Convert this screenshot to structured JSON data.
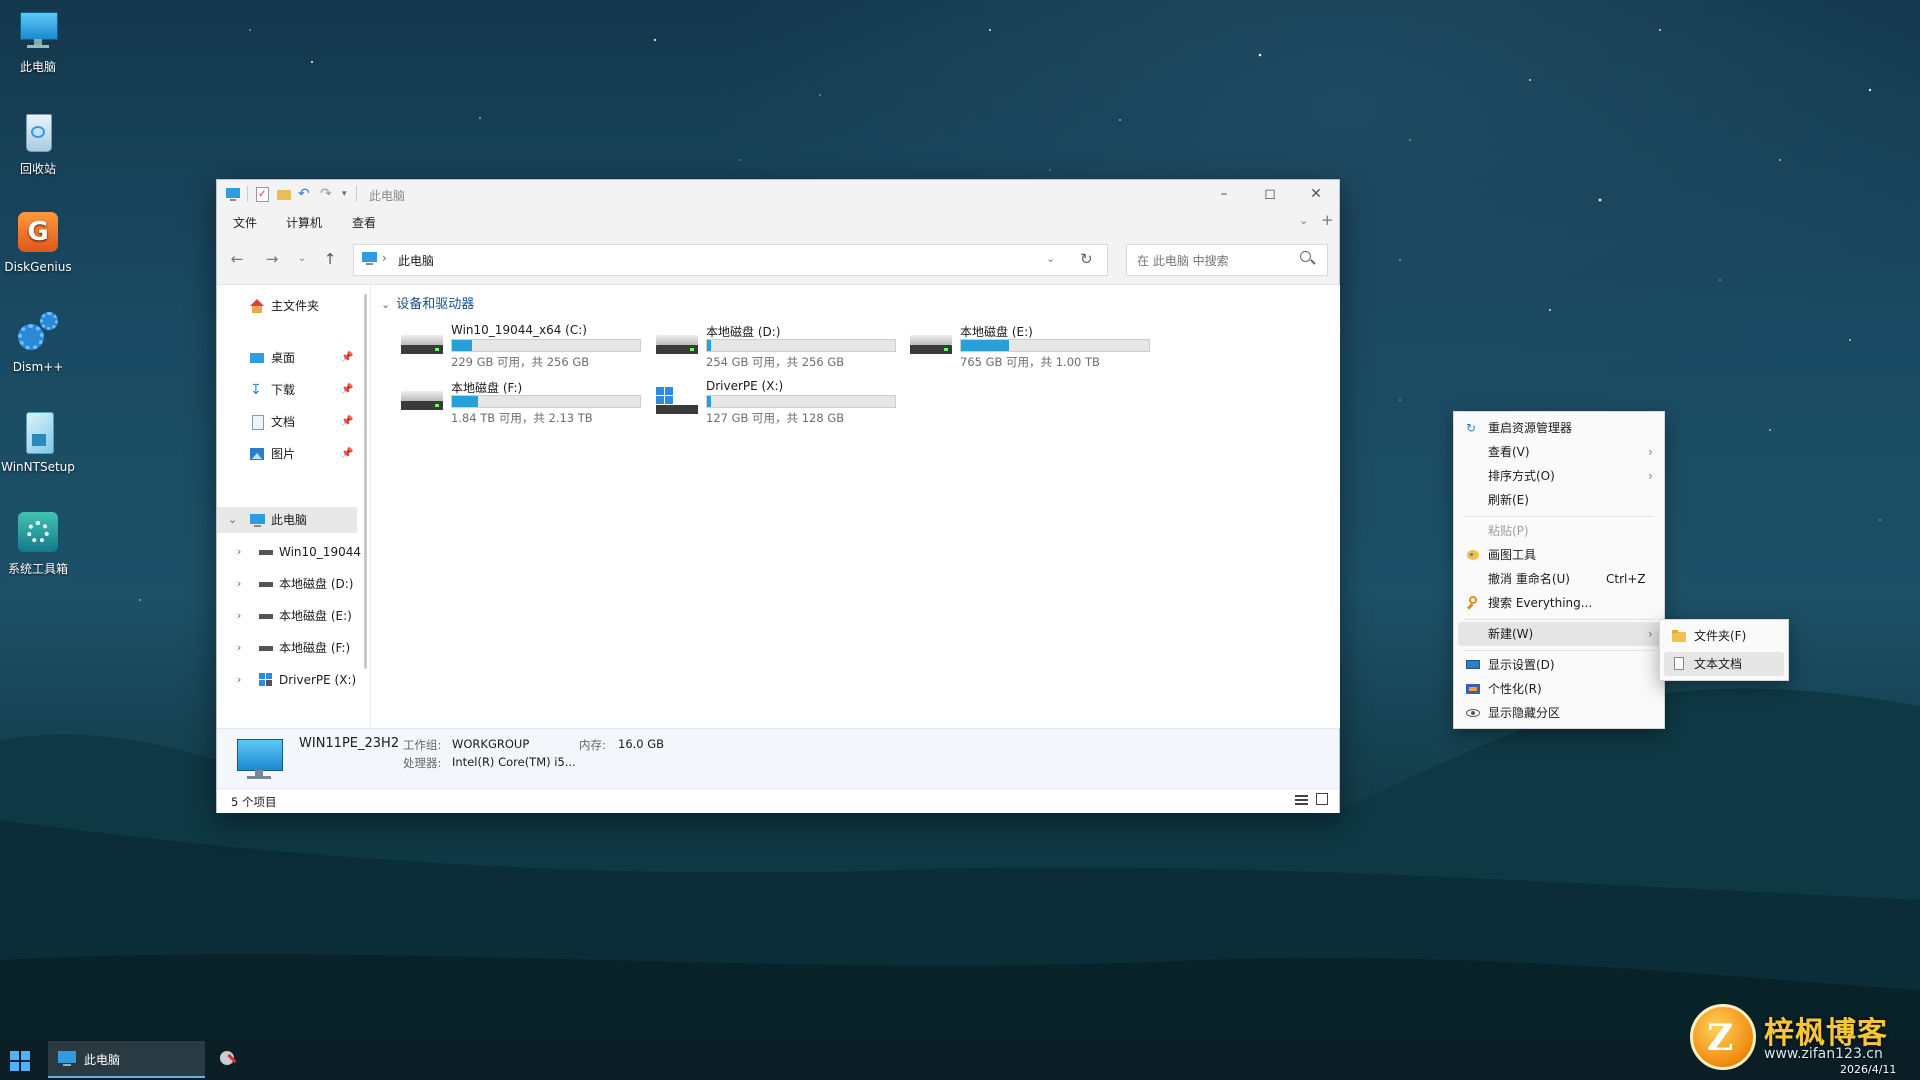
{
  "desktop": {
    "icons": [
      {
        "label": "此电脑",
        "icon": "computer-icon"
      },
      {
        "label": "回收站",
        "icon": "recycle-bin-icon"
      },
      {
        "label": "DiskGenius",
        "icon": "diskgenius-icon"
      },
      {
        "label": "Dism++",
        "icon": "dism-gear-icon"
      },
      {
        "label": "WinNTSetup",
        "icon": "winntsetup-icon"
      },
      {
        "label": "系统工具箱",
        "icon": "system-toolbox-icon"
      }
    ]
  },
  "explorer": {
    "title": "此电脑",
    "menu": [
      "文件",
      "计算机",
      "查看"
    ],
    "address": "此电脑",
    "search_placeholder": "在 此电脑 中搜索",
    "nav": {
      "home": "主文件夹",
      "quick": [
        {
          "label": "桌面",
          "icon": "desktop-folder-icon"
        },
        {
          "label": "下载",
          "icon": "download-icon"
        },
        {
          "label": "文档",
          "icon": "document-icon"
        },
        {
          "label": "图片",
          "icon": "picture-icon"
        }
      ],
      "this_pc": "此电脑",
      "drives": [
        "Win10_19044",
        "本地磁盘 (D:)",
        "本地磁盘 (E:)",
        "本地磁盘 (F:)",
        "DriverPE (X:)"
      ]
    },
    "group_title": "设备和驱动器",
    "drives": [
      {
        "name": "Win10_19044_x64 (C:)",
        "size": "229 GB 可用，共 256 GB",
        "used_fraction": 0.105,
        "icon": "hard-drive-icon"
      },
      {
        "name": "本地磁盘 (D:)",
        "size": "254 GB 可用，共 256 GB",
        "used_fraction": 0.008,
        "icon": "hard-drive-icon"
      },
      {
        "name": "本地磁盘 (E:)",
        "size": "765 GB 可用，共 1.00 TB",
        "used_fraction": 0.253,
        "icon": "hard-drive-icon"
      },
      {
        "name": "本地磁盘 (F:)",
        "size": "1.84 TB 可用，共 2.13 TB",
        "used_fraction": 0.136,
        "icon": "hard-drive-icon"
      },
      {
        "name": "DriverPE (X:)",
        "size": "127 GB 可用，共 128 GB",
        "used_fraction": 0.008,
        "icon": "windows-drive-icon"
      }
    ],
    "details": {
      "computer_name": "WIN11PE_23H2",
      "workgroup_label": "工作组:",
      "workgroup": "WORKGROUP",
      "memory_label": "内存:",
      "memory": "16.0 GB",
      "cpu_label": "处理器:",
      "cpu": "Intel(R) Core(TM) i5..."
    },
    "status": "5 个项目"
  },
  "context_menu": {
    "items": [
      {
        "label": "重启资源管理器",
        "icon": "refresh-icon"
      },
      {
        "label": "查看(V)",
        "submenu": true
      },
      {
        "label": "排序方式(O)",
        "submenu": true
      },
      {
        "label": "刷新(E)"
      },
      {
        "label": "粘贴(P)",
        "disabled": true
      },
      {
        "label": "画图工具",
        "icon": "paint-icon"
      },
      {
        "label": "撤消 重命名(U)",
        "shortcut": "Ctrl+Z"
      },
      {
        "label": "搜索 Everything...",
        "icon": "magnifier-icon"
      },
      {
        "label": "新建(W)",
        "submenu": true
      },
      {
        "label": "显示设置(D)",
        "icon": "display-icon"
      },
      {
        "label": "个性化(R)",
        "icon": "personalize-icon"
      },
      {
        "label": "显示隐藏分区",
        "icon": "eye-icon"
      }
    ],
    "new_submenu": [
      {
        "label": "文件夹(F)",
        "icon": "folder-icon"
      },
      {
        "label": "文本文档",
        "icon": "text-file-icon"
      }
    ]
  },
  "taskbar": {
    "active_window": "此电脑"
  },
  "watermark": {
    "brand": "梓枫博客",
    "url": "www.zifan123.cn",
    "date": "2026/4/11"
  },
  "colors": {
    "accent": "#26a0da",
    "link_blue": "#1a4f8b"
  }
}
